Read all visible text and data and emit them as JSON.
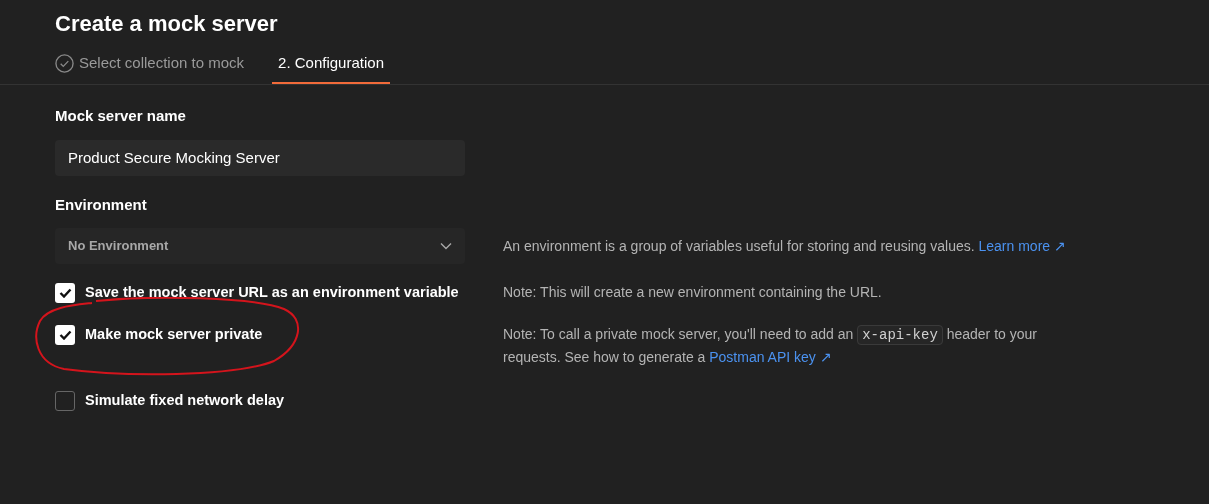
{
  "title": "Create a mock server",
  "steps": [
    {
      "label": "Select collection to mock",
      "completed": true,
      "selected": false
    },
    {
      "label": "2. Configuration",
      "completed": false,
      "selected": true
    }
  ],
  "name_field": {
    "label": "Mock server name",
    "value": "Product Secure Mocking Server"
  },
  "environment": {
    "label": "Environment",
    "value": "No Environment",
    "description": "An environment is a group of variables useful for storing and reusing values.",
    "link": "Learn more ↗"
  },
  "options": [
    {
      "label": "Save the mock server URL as an environment variable",
      "checked": true,
      "annotated": false,
      "note": [
        {
          "kind": "text",
          "text": "Note: This will create a new environment containing the URL."
        }
      ]
    },
    {
      "label": "Make mock server private",
      "checked": true,
      "annotated": true,
      "note": [
        {
          "kind": "text",
          "text": "Note: To call a private mock server, you'll need to add an"
        },
        {
          "kind": "code",
          "text": "x-api-key"
        },
        {
          "kind": "text",
          "text": "header to your requests. See how to generate a"
        },
        {
          "kind": "link",
          "text": "Postman API key ↗"
        }
      ]
    },
    {
      "label": "Simulate fixed network delay",
      "checked": false,
      "annotated": false
    }
  ]
}
